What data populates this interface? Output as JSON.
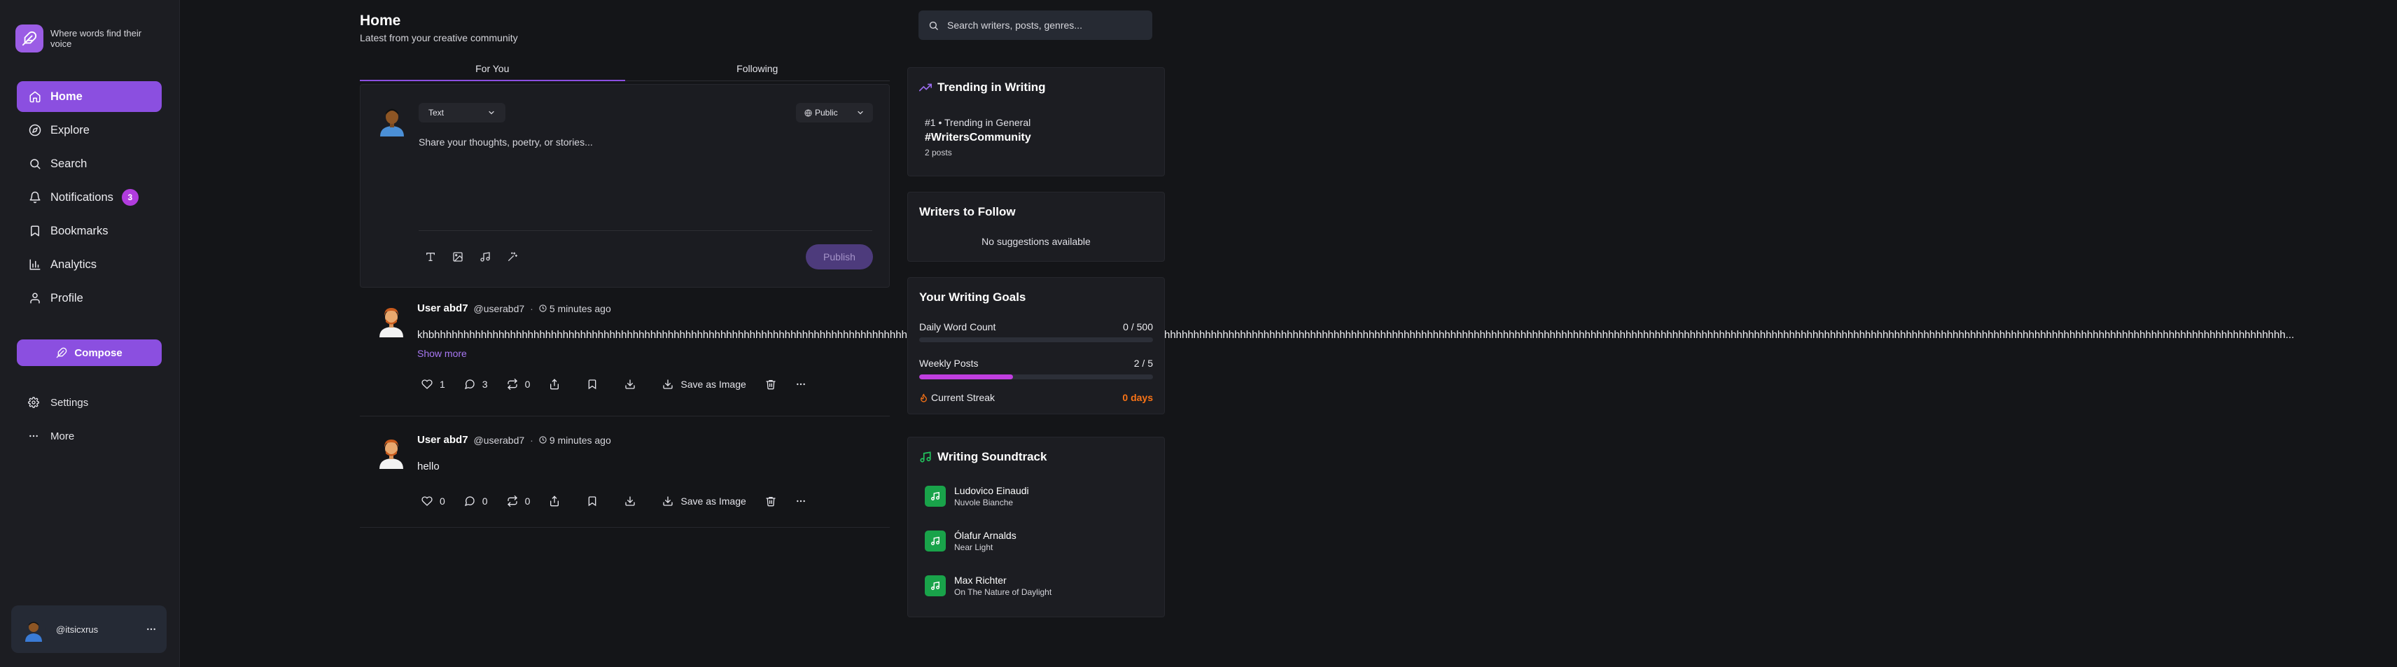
{
  "brand": {
    "tagline": "Where words find their voice"
  },
  "nav": {
    "items": [
      {
        "label": "Home",
        "icon": "home-icon",
        "active": true
      },
      {
        "label": "Explore",
        "icon": "compass-icon"
      },
      {
        "label": "Search",
        "icon": "search-icon"
      },
      {
        "label": "Notifications",
        "icon": "bell-icon",
        "badge": "3"
      },
      {
        "label": "Bookmarks",
        "icon": "bookmark-icon"
      },
      {
        "label": "Analytics",
        "icon": "bar-chart-icon"
      },
      {
        "label": "Profile",
        "icon": "user-icon"
      }
    ],
    "compose_label": "Compose",
    "secondary": [
      {
        "label": "Settings",
        "icon": "gear-icon"
      },
      {
        "label": "More",
        "icon": "ellipsis-icon"
      }
    ]
  },
  "user": {
    "handle": "@itsicxrus"
  },
  "header": {
    "title": "Home",
    "subtitle": "Latest from your creative community"
  },
  "tabs": [
    {
      "label": "For You",
      "active": true
    },
    {
      "label": "Following"
    }
  ],
  "composer": {
    "type_value": "Text",
    "visibility_value": "Public",
    "placeholder": "Share your thoughts, poetry, or stories...",
    "publish_label": "Publish"
  },
  "posts": [
    {
      "author": "User abd7",
      "handle": "@userabd7",
      "time": "5 minutes ago",
      "body": "khbhhhhhhhhhhhhhhhhhhhhhhhhhhhhhhhhhhhhhhhhhhhhhhhhhhhhhhhhhhhhhhhhhhhhhhhhhhhhhhhhhhhhhhhhhhhhhhhhhhhhhhhhhhhhhhhhhhhhhhhhhhhhhhhhhhhhhhhhhhhhhhhhhhhhhhhhhhhhhhhhhhhhhhhhhhhhhhhhhhhhhhhhhhhhhhhhhhhhhhhhhhhhhhhhhhhhhhhhhhhhhhhhhhhhhhhhhhhhhhhhhhhhhhhhhhhhhhhhhhhhhhhhhhhhhhhhhhhhhhhhhhhhhhhhhhhhhhhhhhhhhhhhhhhhhhhhhhhhh...",
      "show_more": "Show more",
      "likes": "1",
      "comments": "3",
      "reposts": "0",
      "save_image_label": "Save as Image"
    },
    {
      "author": "User abd7",
      "handle": "@userabd7",
      "time": "9 minutes ago",
      "body": "hello",
      "likes": "0",
      "comments": "0",
      "reposts": "0",
      "save_image_label": "Save as Image"
    }
  ],
  "search": {
    "placeholder": "Search writers, posts, genres..."
  },
  "trending": {
    "title": "Trending in Writing",
    "meta": "#1 • Trending in General",
    "tag": "#WritersCommunity",
    "count": "2 posts"
  },
  "follow": {
    "title": "Writers to Follow",
    "empty": "No suggestions available"
  },
  "goals": {
    "title": "Your Writing Goals",
    "daily_label": "Daily Word Count",
    "daily_value": "0 / 500",
    "daily_fraction": 0,
    "weekly_label": "Weekly Posts",
    "weekly_value": "2 / 5",
    "weekly_fraction": 0.4,
    "streak_label": "Current Streak",
    "streak_value": "0 days"
  },
  "soundtrack": {
    "title": "Writing Soundtrack",
    "tracks": [
      {
        "artist": "Ludovico Einaudi",
        "title": "Nuvole Bianche"
      },
      {
        "artist": "Ólafur Arnalds",
        "title": "Near Light"
      },
      {
        "artist": "Max Richter",
        "title": "On The Nature of Daylight"
      }
    ]
  },
  "colors": {
    "accent": "#8b4fe0",
    "badge": "#b13cde",
    "progress": "#c03ee0",
    "streak": "#f97316",
    "music": "#19a34a"
  }
}
